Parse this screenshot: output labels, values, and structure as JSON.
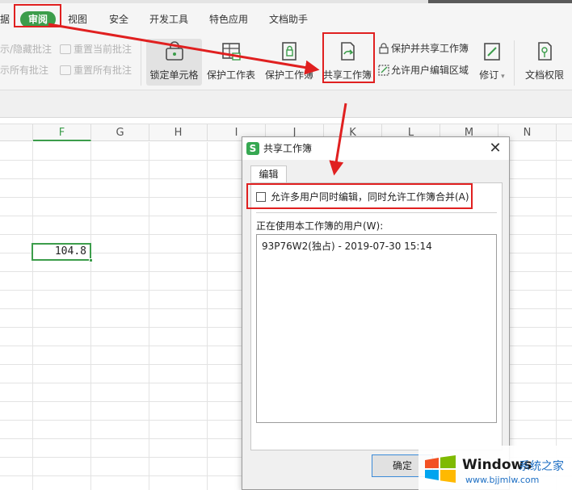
{
  "menu": {
    "tabs": [
      {
        "label": "据"
      },
      {
        "label": "审阅",
        "active": true
      },
      {
        "label": "视图"
      },
      {
        "label": "安全"
      },
      {
        "label": "开发工具"
      },
      {
        "label": "特色应用"
      },
      {
        "label": "文档助手"
      }
    ]
  },
  "ribbon": {
    "comments": {
      "show_hide": "示/隐藏批注",
      "show_all": "示所有批注",
      "reset_current": "重置当前批注",
      "reset_all": "重置所有批注"
    },
    "lock_cells": "锁定单元格",
    "protect_sheet": "保护工作表",
    "protect_workbook": "保护工作簿",
    "share_workbook": "共享工作簿",
    "protect_and_share": "保护并共享工作簿",
    "allow_edit_ranges": "允许用户编辑区域",
    "revisions": "修订",
    "doc_permissions": "文档权限"
  },
  "grid": {
    "columns": [
      "F",
      "G",
      "H",
      "I",
      "J",
      "K",
      "L",
      "M",
      "N"
    ],
    "selected_column": "F",
    "selected_cell_value": "104.8"
  },
  "dialog": {
    "title": "共享工作簿",
    "close": "✕",
    "tab": "编辑",
    "checkbox_label": "允许多用户同时编辑，同时允许工作簿合并(A)",
    "checkbox_checked": false,
    "users_label": "正在使用本工作簿的用户(W):",
    "users": [
      "93P76W2(独占) - 2019-07-30 15:14"
    ],
    "ok_button": "确定"
  },
  "watermark": {
    "brand": "Windows",
    "brand_cn": "系统之家",
    "url": "www.bjjmlw.com"
  },
  "colors": {
    "accent_green": "#3c9d4b",
    "annotation_red": "#e02020"
  }
}
